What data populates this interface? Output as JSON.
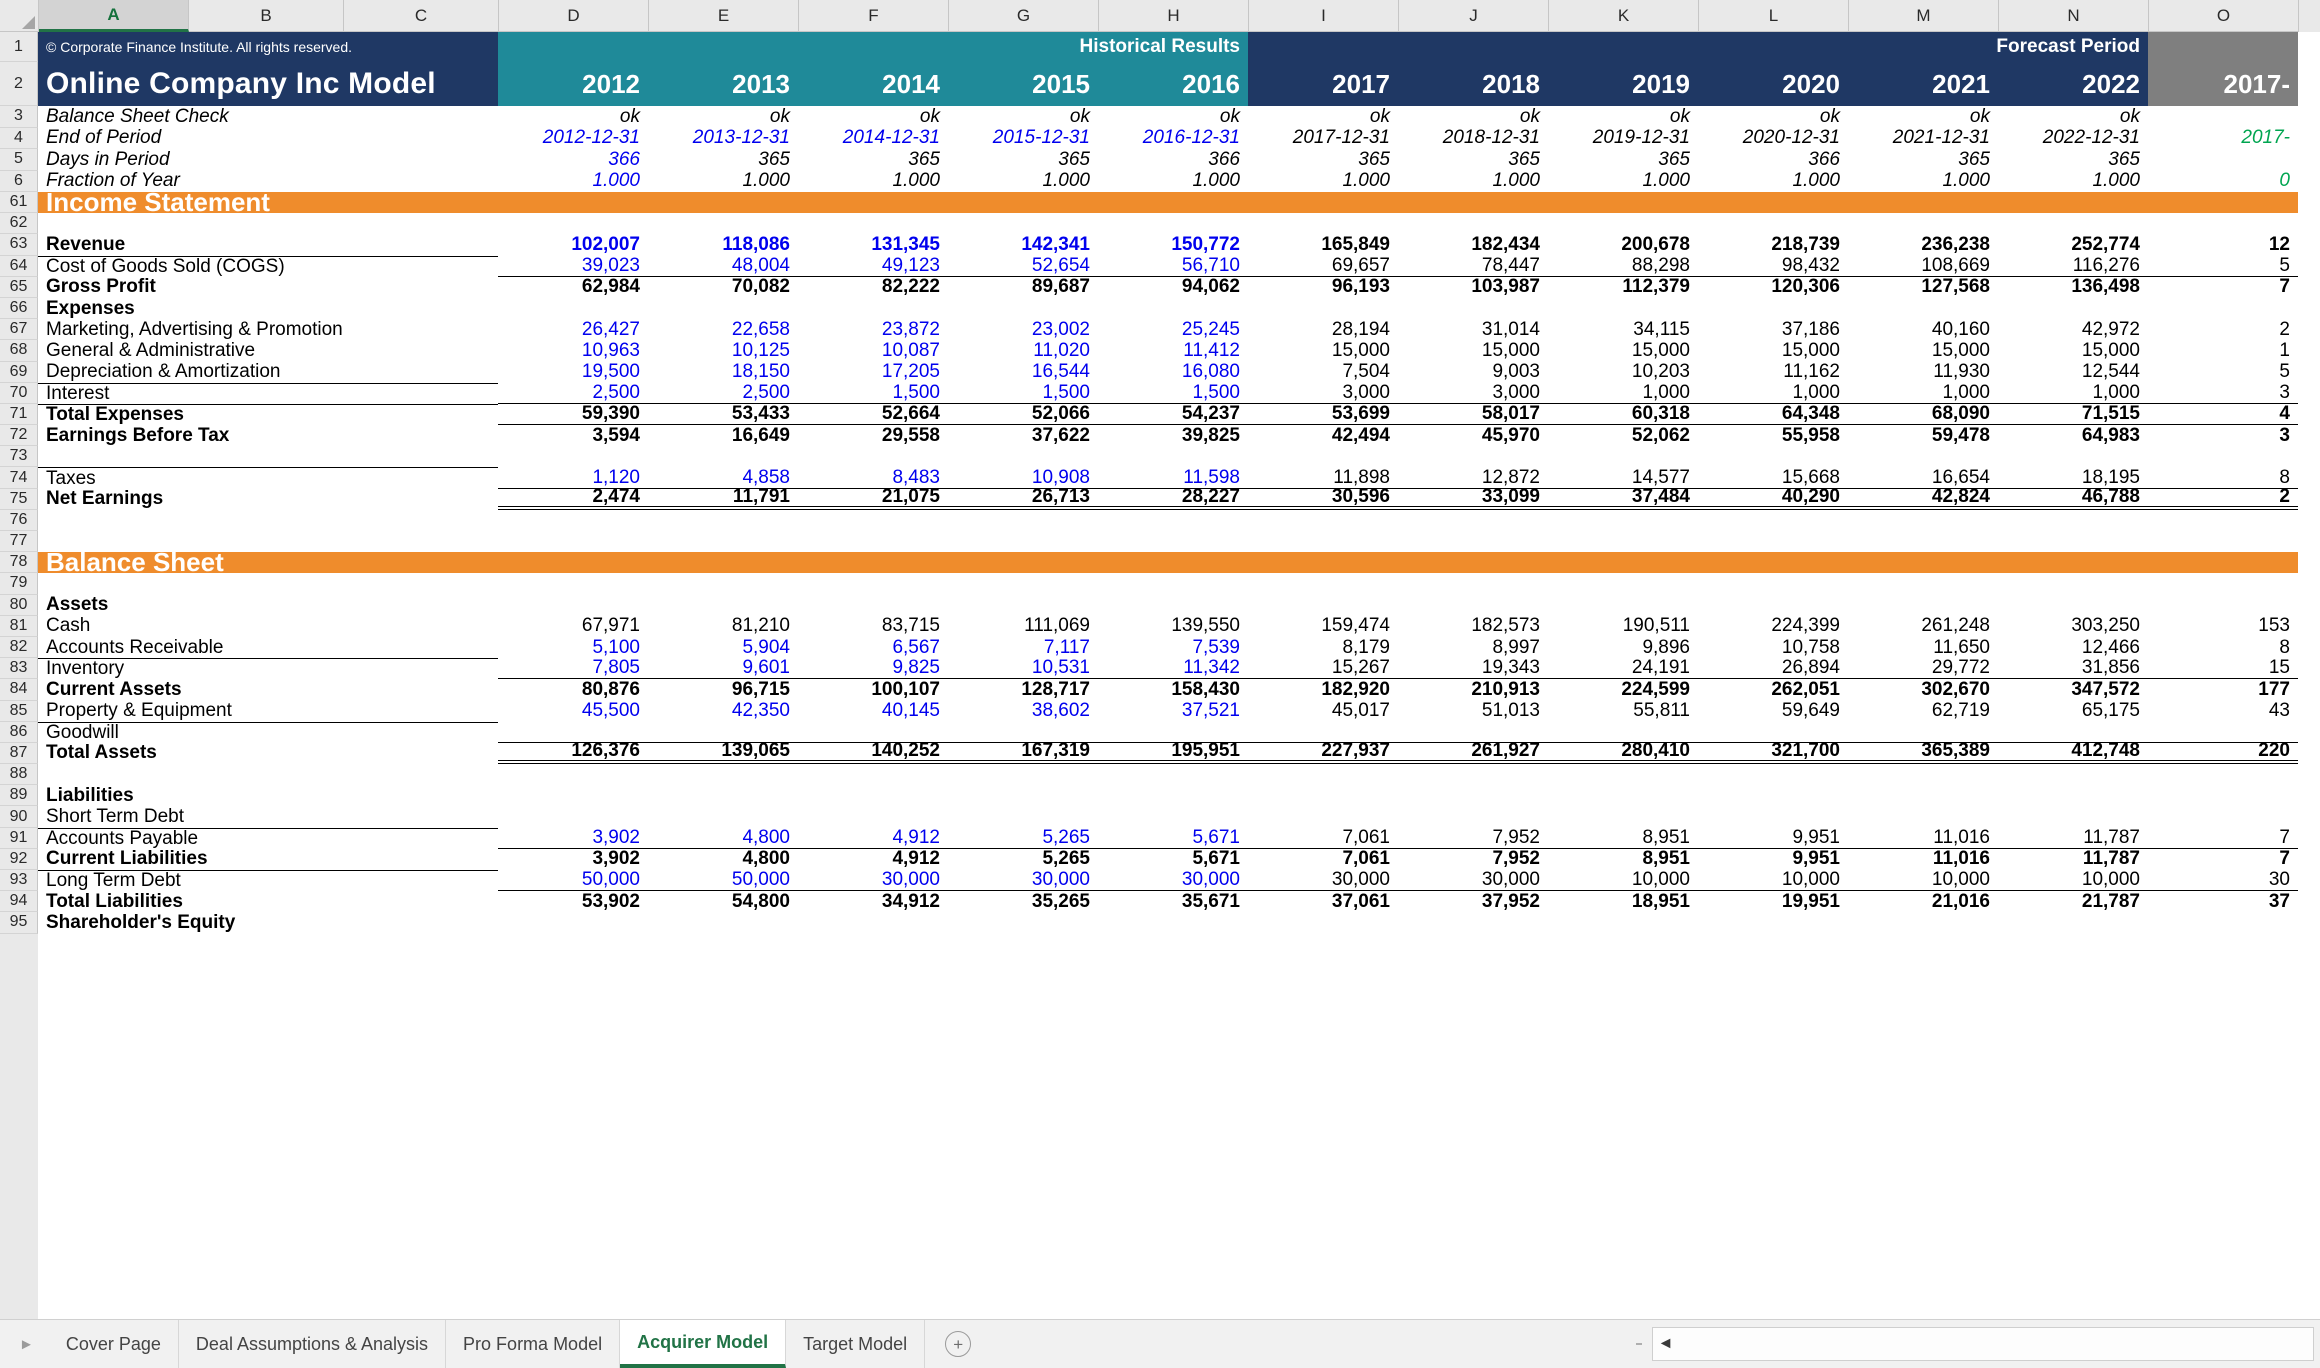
{
  "app": {
    "selected_column": "A",
    "column_headers": [
      "A",
      "B",
      "C",
      "D",
      "E",
      "F",
      "G",
      "H",
      "I",
      "J",
      "K",
      "L",
      "M",
      "N",
      "O"
    ]
  },
  "header": {
    "copyright": "© Corporate Finance Institute. All rights reserved.",
    "title": "Online Company Inc Model",
    "band_historical": "Historical Results",
    "band_forecast": "Forecast Period",
    "years": [
      "2012",
      "2013",
      "2014",
      "2015",
      "2016",
      "2017",
      "2018",
      "2019",
      "2020",
      "2021",
      "2022",
      "2017-"
    ],
    "colors": {
      "navy": "#1f3864",
      "teal": "#1f8a99",
      "orange": "#ef8c2c",
      "gray": "#7f7f7f",
      "blue_input": "#0000ee",
      "green_link": "#00a550",
      "tab_active": "#217346"
    }
  },
  "top_rows": [
    {
      "row": "3",
      "label": "Balance Sheet Check",
      "values": [
        "ok",
        "ok",
        "ok",
        "ok",
        "ok",
        "ok",
        "ok",
        "ok",
        "ok",
        "ok",
        "ok",
        ""
      ],
      "style": "ctr-plain"
    },
    {
      "row": "4",
      "label": "End of Period",
      "values": [
        "2012-12-31",
        "2013-12-31",
        "2014-12-31",
        "2015-12-31",
        "2016-12-31",
        "2017-12-31",
        "2018-12-31",
        "2019-12-31",
        "2020-12-31",
        "2021-12-31",
        "2022-12-31",
        "2017-"
      ],
      "style": "blue-first5"
    },
    {
      "row": "5",
      "label": "Days in Period",
      "values": [
        "366",
        "365",
        "365",
        "365",
        "366",
        "365",
        "365",
        "365",
        "366",
        "365",
        "365",
        ""
      ],
      "style": "blue-first1"
    },
    {
      "row": "6",
      "label": "Fraction of Year",
      "values": [
        "1.000",
        "1.000",
        "1.000",
        "1.000",
        "1.000",
        "1.000",
        "1.000",
        "1.000",
        "1.000",
        "1.000",
        "1.000",
        "0"
      ],
      "style": "blue-first1"
    }
  ],
  "sections": {
    "income_statement": "Income Statement",
    "balance_sheet": "Balance Sheet"
  },
  "income_rows": [
    {
      "row": "61",
      "type": "section",
      "label": "Income Statement"
    },
    {
      "row": "62",
      "type": "blank",
      "label": "",
      "values": [
        "",
        "",
        "",
        "",
        "",
        "",
        "",
        "",
        "",
        "",
        "",
        ""
      ]
    },
    {
      "row": "63",
      "type": "data",
      "label": "Revenue",
      "bold": true,
      "hist_blue": true,
      "values": [
        "102,007",
        "118,086",
        "131,345",
        "142,341",
        "150,772",
        "165,849",
        "182,434",
        "200,678",
        "218,739",
        "236,238",
        "252,774",
        "12"
      ]
    },
    {
      "row": "64",
      "type": "data",
      "label": "Cost of Goods Sold (COGS)",
      "bold": false,
      "hist_blue": true,
      "border": "bb",
      "values": [
        "39,023",
        "48,004",
        "49,123",
        "52,654",
        "56,710",
        "69,657",
        "78,447",
        "88,298",
        "98,432",
        "108,669",
        "116,276",
        "5"
      ]
    },
    {
      "row": "65",
      "type": "data",
      "label": "Gross Profit",
      "bold": true,
      "hist_blue": false,
      "values": [
        "62,984",
        "70,082",
        "82,222",
        "89,687",
        "94,062",
        "96,193",
        "103,987",
        "112,379",
        "120,306",
        "127,568",
        "136,498",
        "7"
      ]
    },
    {
      "row": "66",
      "type": "data",
      "label": "Expenses",
      "bold": true,
      "hist_blue": false,
      "values": [
        "",
        "",
        "",
        "",
        "",
        "",
        "",
        "",
        "",
        "",
        "",
        ""
      ]
    },
    {
      "row": "67",
      "type": "data",
      "label": "Marketing, Advertising & Promotion",
      "bold": false,
      "hist_blue": true,
      "values": [
        "26,427",
        "22,658",
        "23,872",
        "23,002",
        "25,245",
        "28,194",
        "31,014",
        "34,115",
        "37,186",
        "40,160",
        "42,972",
        "2"
      ]
    },
    {
      "row": "68",
      "type": "data",
      "label": "General & Administrative",
      "bold": false,
      "hist_blue": true,
      "values": [
        "10,963",
        "10,125",
        "10,087",
        "11,020",
        "11,412",
        "15,000",
        "15,000",
        "15,000",
        "15,000",
        "15,000",
        "15,000",
        "1"
      ]
    },
    {
      "row": "69",
      "type": "data",
      "label": "Depreciation & Amortization",
      "bold": false,
      "hist_blue": true,
      "values": [
        "19,500",
        "18,150",
        "17,205",
        "16,544",
        "16,080",
        "7,504",
        "9,003",
        "10,203",
        "11,162",
        "11,930",
        "12,544",
        "5"
      ]
    },
    {
      "row": "70",
      "type": "data",
      "label": "Interest",
      "bold": false,
      "hist_blue": true,
      "border": "bb",
      "values": [
        "2,500",
        "2,500",
        "1,500",
        "1,500",
        "1,500",
        "3,000",
        "3,000",
        "1,000",
        "1,000",
        "1,000",
        "1,000",
        "3"
      ]
    },
    {
      "row": "71",
      "type": "data",
      "label": "Total Expenses",
      "bold": true,
      "hist_blue": false,
      "border": "bb",
      "values": [
        "59,390",
        "53,433",
        "52,664",
        "52,066",
        "54,237",
        "53,699",
        "58,017",
        "60,318",
        "64,348",
        "68,090",
        "71,515",
        "4"
      ]
    },
    {
      "row": "72",
      "type": "data",
      "label": "Earnings Before Tax",
      "bold": true,
      "hist_blue": false,
      "values": [
        "3,594",
        "16,649",
        "29,558",
        "37,622",
        "39,825",
        "42,494",
        "45,970",
        "52,062",
        "55,958",
        "59,478",
        "64,983",
        "3"
      ]
    },
    {
      "row": "73",
      "type": "blank",
      "label": "",
      "values": [
        "",
        "",
        "",
        "",
        "",
        "",
        "",
        "",
        "",
        "",
        "",
        ""
      ]
    },
    {
      "row": "74",
      "type": "data",
      "label": "Taxes",
      "bold": false,
      "hist_blue": true,
      "border": "bb",
      "values": [
        "1,120",
        "4,858",
        "8,483",
        "10,908",
        "11,598",
        "11,898",
        "12,872",
        "14,577",
        "15,668",
        "16,654",
        "18,195",
        "8"
      ]
    },
    {
      "row": "75",
      "type": "data",
      "label": "Net Earnings",
      "bold": true,
      "hist_blue": false,
      "border": "dbl",
      "values": [
        "2,474",
        "11,791",
        "21,075",
        "26,713",
        "28,227",
        "30,596",
        "33,099",
        "37,484",
        "40,290",
        "42,824",
        "46,788",
        "2"
      ]
    },
    {
      "row": "76",
      "type": "blank",
      "label": "",
      "values": [
        "",
        "",
        "",
        "",
        "",
        "",
        "",
        "",
        "",
        "",
        "",
        ""
      ]
    },
    {
      "row": "77",
      "type": "blank",
      "label": "",
      "values": [
        "",
        "",
        "",
        "",
        "",
        "",
        "",
        "",
        "",
        "",
        "",
        ""
      ]
    },
    {
      "row": "78",
      "type": "section",
      "label": "Balance Sheet"
    },
    {
      "row": "79",
      "type": "blank",
      "label": "",
      "values": [
        "",
        "",
        "",
        "",
        "",
        "",
        "",
        "",
        "",
        "",
        "",
        ""
      ]
    },
    {
      "row": "80",
      "type": "data",
      "label": "Assets",
      "bold": true,
      "hist_blue": false,
      "values": [
        "",
        "",
        "",
        "",
        "",
        "",
        "",
        "",
        "",
        "",
        "",
        ""
      ]
    },
    {
      "row": "81",
      "type": "data",
      "label": "Cash",
      "bold": false,
      "hist_blue": false,
      "values": [
        "67,971",
        "81,210",
        "83,715",
        "111,069",
        "139,550",
        "159,474",
        "182,573",
        "190,511",
        "224,399",
        "261,248",
        "303,250",
        "153"
      ]
    },
    {
      "row": "82",
      "type": "data",
      "label": "Accounts Receivable",
      "bold": false,
      "hist_blue": true,
      "values": [
        "5,100",
        "5,904",
        "6,567",
        "7,117",
        "7,539",
        "8,179",
        "8,997",
        "9,896",
        "10,758",
        "11,650",
        "12,466",
        "8"
      ]
    },
    {
      "row": "83",
      "type": "data",
      "label": "Inventory",
      "bold": false,
      "hist_blue": true,
      "border": "bb",
      "values": [
        "7,805",
        "9,601",
        "9,825",
        "10,531",
        "11,342",
        "15,267",
        "19,343",
        "24,191",
        "26,894",
        "29,772",
        "31,856",
        "15"
      ]
    },
    {
      "row": "84",
      "type": "data",
      "label": "Current Assets",
      "bold": true,
      "hist_blue": false,
      "values": [
        "80,876",
        "96,715",
        "100,107",
        "128,717",
        "158,430",
        "182,920",
        "210,913",
        "224,599",
        "262,051",
        "302,670",
        "347,572",
        "177"
      ]
    },
    {
      "row": "85",
      "type": "data",
      "label": "Property & Equipment",
      "bold": false,
      "hist_blue": true,
      "values": [
        "45,500",
        "42,350",
        "40,145",
        "38,602",
        "37,521",
        "45,017",
        "51,013",
        "55,811",
        "59,649",
        "62,719",
        "65,175",
        "43"
      ]
    },
    {
      "row": "86",
      "type": "data",
      "label": "Goodwill",
      "bold": false,
      "hist_blue": false,
      "border": "bb",
      "values": [
        "",
        "",
        "",
        "",
        "",
        "",
        "",
        "",
        "",
        "",
        "",
        ""
      ]
    },
    {
      "row": "87",
      "type": "data",
      "label": "Total Assets",
      "bold": true,
      "hist_blue": false,
      "border": "dbl",
      "values": [
        "126,376",
        "139,065",
        "140,252",
        "167,319",
        "195,951",
        "227,937",
        "261,927",
        "280,410",
        "321,700",
        "365,389",
        "412,748",
        "220"
      ]
    },
    {
      "row": "88",
      "type": "blank",
      "label": "",
      "values": [
        "",
        "",
        "",
        "",
        "",
        "",
        "",
        "",
        "",
        "",
        "",
        ""
      ]
    },
    {
      "row": "89",
      "type": "data",
      "label": "Liabilities",
      "bold": true,
      "hist_blue": false,
      "values": [
        "",
        "",
        "",
        "",
        "",
        "",
        "",
        "",
        "",
        "",
        "",
        ""
      ]
    },
    {
      "row": "90",
      "type": "data",
      "label": "Short Term Debt",
      "bold": false,
      "hist_blue": false,
      "values": [
        "",
        "",
        "",
        "",
        "",
        "",
        "",
        "",
        "",
        "",
        "",
        ""
      ]
    },
    {
      "row": "91",
      "type": "data",
      "label": "Accounts Payable",
      "bold": false,
      "hist_blue": true,
      "border": "bb",
      "values": [
        "3,902",
        "4,800",
        "4,912",
        "5,265",
        "5,671",
        "7,061",
        "7,952",
        "8,951",
        "9,951",
        "11,016",
        "11,787",
        "7"
      ]
    },
    {
      "row": "92",
      "type": "data",
      "label": "Current Liabilities",
      "bold": true,
      "hist_blue": false,
      "values": [
        "3,902",
        "4,800",
        "4,912",
        "5,265",
        "5,671",
        "7,061",
        "7,952",
        "8,951",
        "9,951",
        "11,016",
        "11,787",
        "7"
      ]
    },
    {
      "row": "93",
      "type": "data",
      "label": "Long Term Debt",
      "bold": false,
      "hist_blue": true,
      "border": "bb",
      "values": [
        "50,000",
        "50,000",
        "30,000",
        "30,000",
        "30,000",
        "30,000",
        "30,000",
        "10,000",
        "10,000",
        "10,000",
        "10,000",
        "30"
      ]
    },
    {
      "row": "94",
      "type": "data",
      "label": "Total Liabilities",
      "bold": true,
      "hist_blue": false,
      "values": [
        "53,902",
        "54,800",
        "34,912",
        "35,265",
        "35,671",
        "37,061",
        "37,952",
        "18,951",
        "19,951",
        "21,016",
        "21,787",
        "37"
      ]
    },
    {
      "row": "95",
      "type": "data",
      "label": "Shareholder's Equity",
      "bold": true,
      "hist_blue": false,
      "values": [
        "",
        "",
        "",
        "",
        "",
        "",
        "",
        "",
        "",
        "",
        "",
        ""
      ]
    }
  ],
  "tabs": {
    "items": [
      {
        "label": "Cover Page",
        "active": false
      },
      {
        "label": "Deal Assumptions & Analysis",
        "active": false
      },
      {
        "label": "Pro Forma Model",
        "active": false
      },
      {
        "label": "Acquirer Model",
        "active": true
      },
      {
        "label": "Target Model",
        "active": false
      }
    ],
    "add_label": "+",
    "nav_left": "◄",
    "nav_right": "►",
    "scroll_left_arrow": "◄"
  }
}
